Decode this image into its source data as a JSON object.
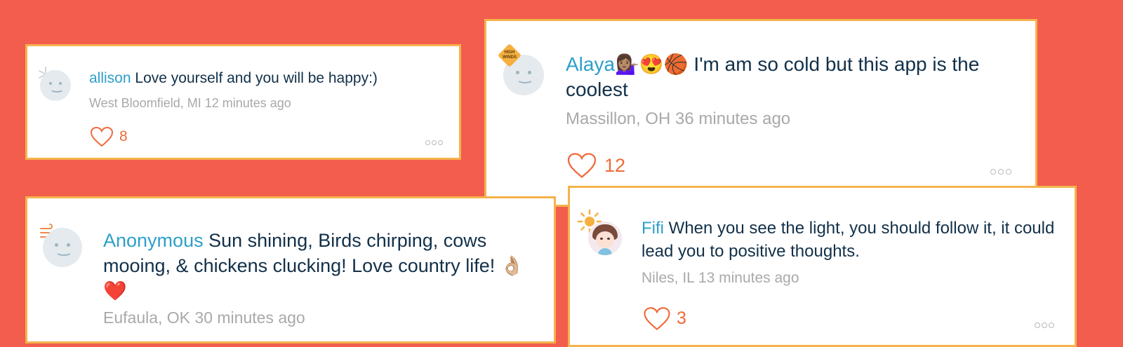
{
  "colors": {
    "background": "#f25d4d",
    "card_border": "#f4b34c",
    "username": "#2d9fc9",
    "text": "#123049",
    "meta": "#a9a9a9",
    "like": "#ef6a3a"
  },
  "posts": [
    {
      "username": "allison",
      "message": "Love yourself and you will be happy:)",
      "location": "West Bloomfield, MI",
      "time": "12 minutes ago",
      "likes": "8",
      "weather_icon": "snowflake-icon"
    },
    {
      "username": "Alaya",
      "emojis": "💁🏽‍♀️😍🏀",
      "message": "I'm am so cold but this app is the coolest",
      "location": "Massillon, OH",
      "time": "36 minutes ago",
      "likes": "12",
      "weather_icon": "high-winds-sign-icon",
      "badge_text": "HIGH WINDS"
    },
    {
      "username": "Anonymous",
      "message": "Sun shining, Birds chirping, cows mooing, & chickens clucking! Love country life!",
      "emojis": "👌🏼❤️",
      "location": "Eufaula, OK",
      "time": "30 minutes ago",
      "weather_icon": "wind-icon"
    },
    {
      "username": "Fifi",
      "message": "When you see the light, you should follow it, it could lead you to positive thoughts.",
      "location": "Niles, IL",
      "time": "13 minutes ago",
      "likes": "3",
      "weather_icon": "sun-icon"
    }
  ]
}
